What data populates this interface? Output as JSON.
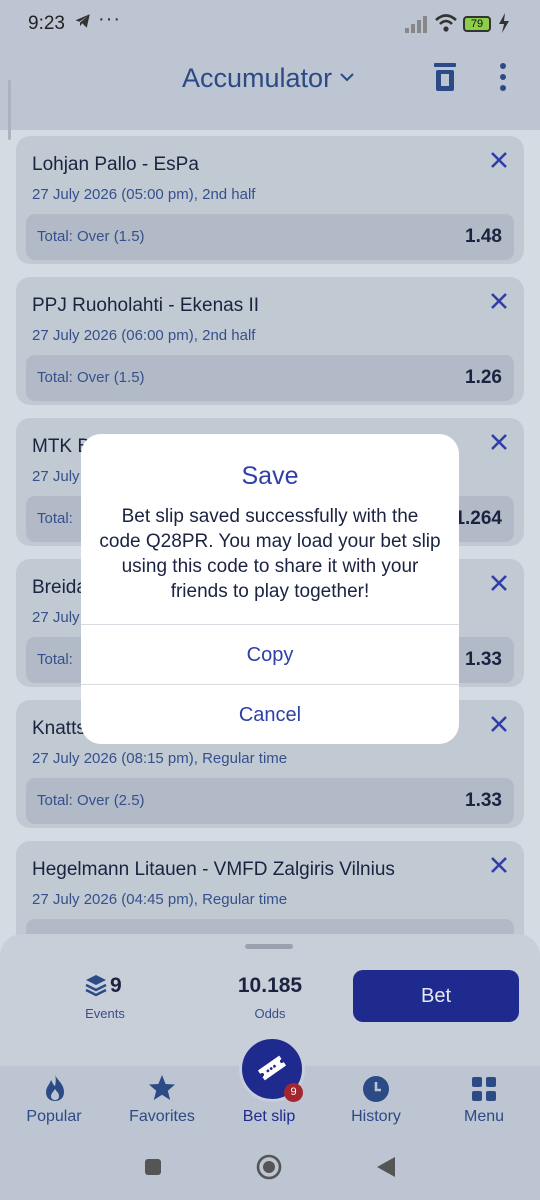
{
  "status": {
    "time": "9:23",
    "dots": "···",
    "battery": "79"
  },
  "header": {
    "title": "Accumulator"
  },
  "cards": [
    {
      "title": "Lohjan Pallo - EsPa",
      "subtitle": "27 July 2026 (05:00 pm), 2nd half",
      "market": "Total: Over (1.5)",
      "odds": "1.48"
    },
    {
      "title": "PPJ Ruoholahti - Ekenas II",
      "subtitle": "27 July 2026 (06:00 pm), 2nd half",
      "market": "Total: Over (1.5)",
      "odds": "1.26"
    },
    {
      "title": "MTK B",
      "subtitle": "27 July",
      "market": "Total:",
      "odds": "1.264"
    },
    {
      "title": "Breida",
      "subtitle": "27 July",
      "market": "Total:",
      "odds": "1.33"
    },
    {
      "title": "Knatts",
      "subtitle": "27 July 2026 (08:15 pm), Regular time",
      "market": "Total: Over (2.5)",
      "odds": "1.33"
    },
    {
      "title": "Hegelmann Litauen - VMFD Zalgiris Vilnius",
      "subtitle": "27 July 2026 (04:45 pm), Regular time",
      "market": "",
      "odds": ""
    }
  ],
  "summary": {
    "events_count": "9",
    "events_label": "Events",
    "odds_value": "10.185",
    "odds_label": "Odds",
    "bet_label": "Bet"
  },
  "nav": {
    "items": [
      {
        "label": "Popular",
        "icon": "flame-icon"
      },
      {
        "label": "Favorites",
        "icon": "star-icon"
      },
      {
        "label": "Bet slip",
        "icon": "ticket-icon",
        "badge": "9"
      },
      {
        "label": "History",
        "icon": "clock-icon"
      },
      {
        "label": "Menu",
        "icon": "grid-icon"
      }
    ]
  },
  "dialog": {
    "title": "Save",
    "message": "Bet slip saved successfully with the code Q28PR. You may load your bet slip using this code to share it with your friends to play together!",
    "copy_label": "Copy",
    "cancel_label": "Cancel"
  },
  "colors": {
    "accent": "#1e2a8e",
    "dialog_text": "#2f3fa8",
    "badge": "#a3262e",
    "battery": "#8bd048"
  }
}
